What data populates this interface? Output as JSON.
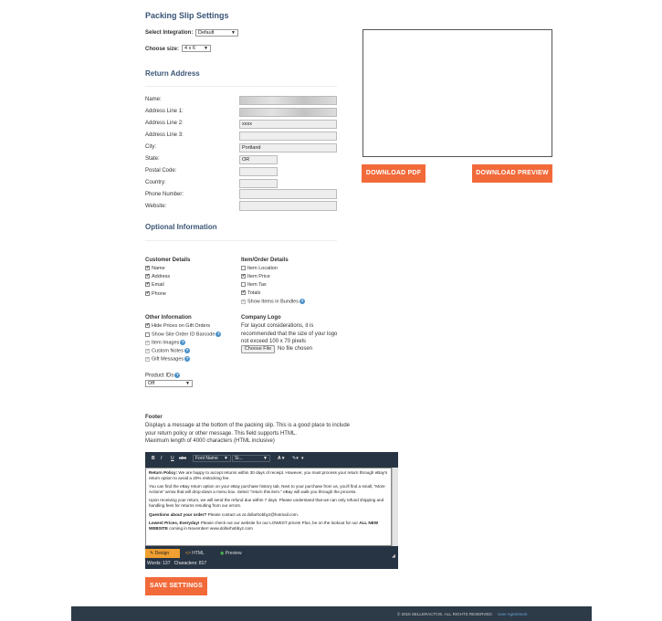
{
  "page_title": "Packing Slip Settings",
  "integration": {
    "label": "Select Integration:",
    "value": "Default"
  },
  "size": {
    "label": "Choose size:",
    "value": "4 x 6"
  },
  "return_address": {
    "heading": "Return Address",
    "fields": [
      {
        "label": "Name:",
        "value": ""
      },
      {
        "label": "Address Line 1:",
        "value": ""
      },
      {
        "label": "Address Line 2:",
        "value": "xxxx"
      },
      {
        "label": "Address Line 3:",
        "value": ""
      },
      {
        "label": "City:",
        "value": "Portland"
      },
      {
        "label": "State:",
        "value": "OR"
      },
      {
        "label": "Postal Code:",
        "value": ""
      },
      {
        "label": "Country:",
        "value": ""
      },
      {
        "label": "Phone Number:",
        "value": ""
      },
      {
        "label": "Website:",
        "value": ""
      }
    ]
  },
  "optional": {
    "heading": "Optional Information",
    "customer_details": {
      "title": "Customer Details",
      "items": [
        {
          "label": "Name",
          "checked": true
        },
        {
          "label": "Address",
          "checked": true
        },
        {
          "label": "Email",
          "checked": true
        },
        {
          "label": "Phone",
          "checked": true
        }
      ]
    },
    "order_details": {
      "title": "Item/Order Details",
      "items": [
        {
          "label": "Item Location",
          "checked": false
        },
        {
          "label": "Item Price",
          "checked": true
        },
        {
          "label": "Item Tax",
          "checked": false
        },
        {
          "label": "Totals",
          "checked": true
        },
        {
          "label": "Show Items in Bundles",
          "checked": true
        }
      ]
    },
    "other_info": {
      "title": "Other Information",
      "items": [
        {
          "label": "Hide Prices on Gift Orders",
          "checked": true
        },
        {
          "label": "Show Site Order ID Barcode",
          "checked": false
        },
        {
          "label": "Item Images",
          "checked": true
        },
        {
          "label": "Custom Notes",
          "checked": true
        },
        {
          "label": "Gift Messages",
          "checked": true
        }
      ]
    },
    "company_logo": {
      "title": "Company Logo",
      "text": "For layout considerations, it is recommended that the size of your logo not exceed 100 x 70 pixels",
      "choose_file": "Choose File",
      "no_file": "No file chosen"
    },
    "product_ids": {
      "label": "Product IDs",
      "value": "Off"
    }
  },
  "footer_section": {
    "title": "Footer",
    "description": "Displays a message at the bottom of the packing slip. This is a good place to include your return policy or other message. This field supports HTML.",
    "max_length": "Maximum length of 4000 characters (HTML inclusive)"
  },
  "editor": {
    "toolbar": {
      "bold": "B",
      "italic": "I",
      "underline": "U",
      "strike": "abc",
      "font_name": "Font Name",
      "font_size": "Si..."
    },
    "content": {
      "p1_bold": "Return Policy:",
      "p1": "We are happy to accept returns within 30 days of receipt. However, you must process your return through eBay's return option to avoid a 20% restocking fee.",
      "p2": "You can find the eBay return option on your eBay purchase history tab. Next to your purchase from us, you'll find a small, \"More Actions\" arrow that will drop-down a menu box. Select \"return this item.\" eBay will walk you through the process.",
      "p3": "Upon receiving your return, we will send the refund due within 7 days. Please understand that we can only refund shipping and handling fees for returns resulting from our errors.",
      "p4_bold": "Questions about your order?",
      "p4": "Please contact us at dollarhobbyz@hotmail.com.",
      "p5_bold": "Lowest Prices, Everyday!",
      "p5": "Please check out our website for our LOWEST prices! Plus, be on the lookout for our",
      "p5_bold2": "ALL NEW WEBSITE",
      "p5_tail": "coming in November! www.dollarhobbyz.com"
    },
    "tabs": {
      "design": "Design",
      "html": "HTML",
      "preview": "Preview"
    },
    "stats": "Words: 137   Characters: 817"
  },
  "buttons": {
    "save": "SAVE SETTINGS",
    "download_pdf": "DOWNLOAD PDF",
    "download_preview": "DOWNLOAD PREVIEW"
  },
  "site_footer": {
    "copyright": "© 2015 SELLERACTIVE. ALL RIGHTS RESERVED.",
    "link": "User Agreement"
  }
}
